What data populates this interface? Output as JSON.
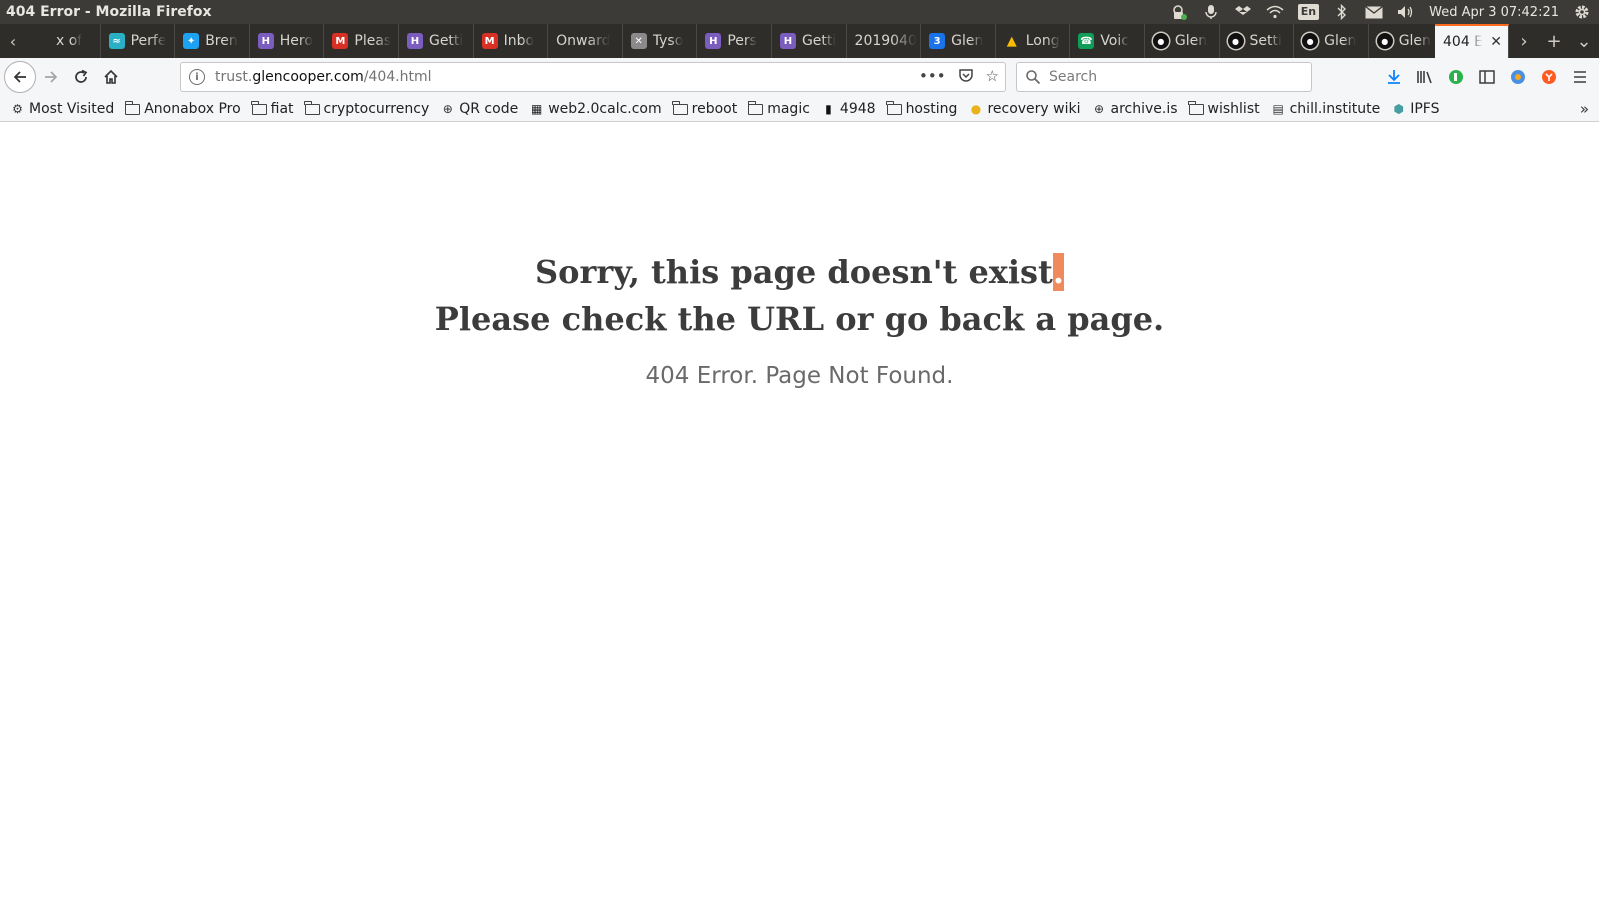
{
  "window": {
    "title": "404 Error - Mozilla Firefox",
    "clock": "Wed Apr  3 07:42:21",
    "lang": "En"
  },
  "tabs": [
    {
      "label": "x of",
      "icon": "blank-icon",
      "color": "#2e2d2a"
    },
    {
      "label": "Perfe",
      "icon": "perf-icon",
      "color": "#2ab0c5"
    },
    {
      "label": "Bren",
      "icon": "twitter-icon",
      "color": "#1da1f2"
    },
    {
      "label": "Hero",
      "icon": "heroku-icon",
      "color": "#7b5dc0"
    },
    {
      "label": "Pleas",
      "icon": "gmail-icon",
      "color": "#d93025"
    },
    {
      "label": "Getti",
      "icon": "heroku-icon",
      "color": "#7b5dc0"
    },
    {
      "label": "Inbo",
      "icon": "gmail-icon",
      "color": "#d93025"
    },
    {
      "label": "Onward",
      "icon": "none",
      "color": ""
    },
    {
      "label": "Tyso",
      "icon": "x-circle-icon",
      "color": "#8a8a8a"
    },
    {
      "label": "Pers",
      "icon": "heroku-icon",
      "color": "#7b5dc0"
    },
    {
      "label": "Getti",
      "icon": "heroku-icon",
      "color": "#7b5dc0"
    },
    {
      "label": "2019040",
      "icon": "none",
      "color": ""
    },
    {
      "label": "Glen",
      "icon": "calendar-icon",
      "color": "#1a73e8"
    },
    {
      "label": "Long",
      "icon": "drive-icon",
      "color": "#fbbc04"
    },
    {
      "label": "Voic",
      "icon": "voice-icon",
      "color": "#0f9d58"
    },
    {
      "label": "Glen",
      "icon": "github-icon",
      "color": "#111111"
    },
    {
      "label": "Setti",
      "icon": "github-icon",
      "color": "#111111"
    },
    {
      "label": "Glen",
      "icon": "github-icon",
      "color": "#111111"
    },
    {
      "label": "Glen",
      "icon": "github-icon",
      "color": "#111111"
    }
  ],
  "active_tab": {
    "label": "404 E"
  },
  "navbar": {
    "url_prefix": "trust.",
    "url_domain": "glencooper.com",
    "url_path": "/404.html",
    "search_placeholder": "Search"
  },
  "bookmarks": [
    {
      "label": "Most Visited",
      "icon": "gear-icon"
    },
    {
      "label": "Anonabox Pro",
      "icon": "folder-icon"
    },
    {
      "label": "fiat",
      "icon": "folder-icon"
    },
    {
      "label": "cryptocurrency",
      "icon": "folder-icon"
    },
    {
      "label": "QR code",
      "icon": "globe-icon"
    },
    {
      "label": "web2.0calc.com",
      "icon": "calc-icon"
    },
    {
      "label": "reboot",
      "icon": "folder-icon"
    },
    {
      "label": "magic",
      "icon": "folder-icon"
    },
    {
      "label": "4948",
      "icon": "chart-icon"
    },
    {
      "label": "hosting",
      "icon": "folder-icon"
    },
    {
      "label": "recovery wiki",
      "icon": "coin-icon"
    },
    {
      "label": "archive.is",
      "icon": "globe-icon"
    },
    {
      "label": "wishlist",
      "icon": "folder-icon"
    },
    {
      "label": "chill.institute",
      "icon": "clapper-icon"
    },
    {
      "label": "IPFS",
      "icon": "cube-icon"
    }
  ],
  "page": {
    "headline_line1": "Sorry, this page doesn't exist",
    "headline_dot": ".",
    "headline_line2": "Please check the URL or go back a page.",
    "subline": "404 Error. Page Not Found."
  }
}
